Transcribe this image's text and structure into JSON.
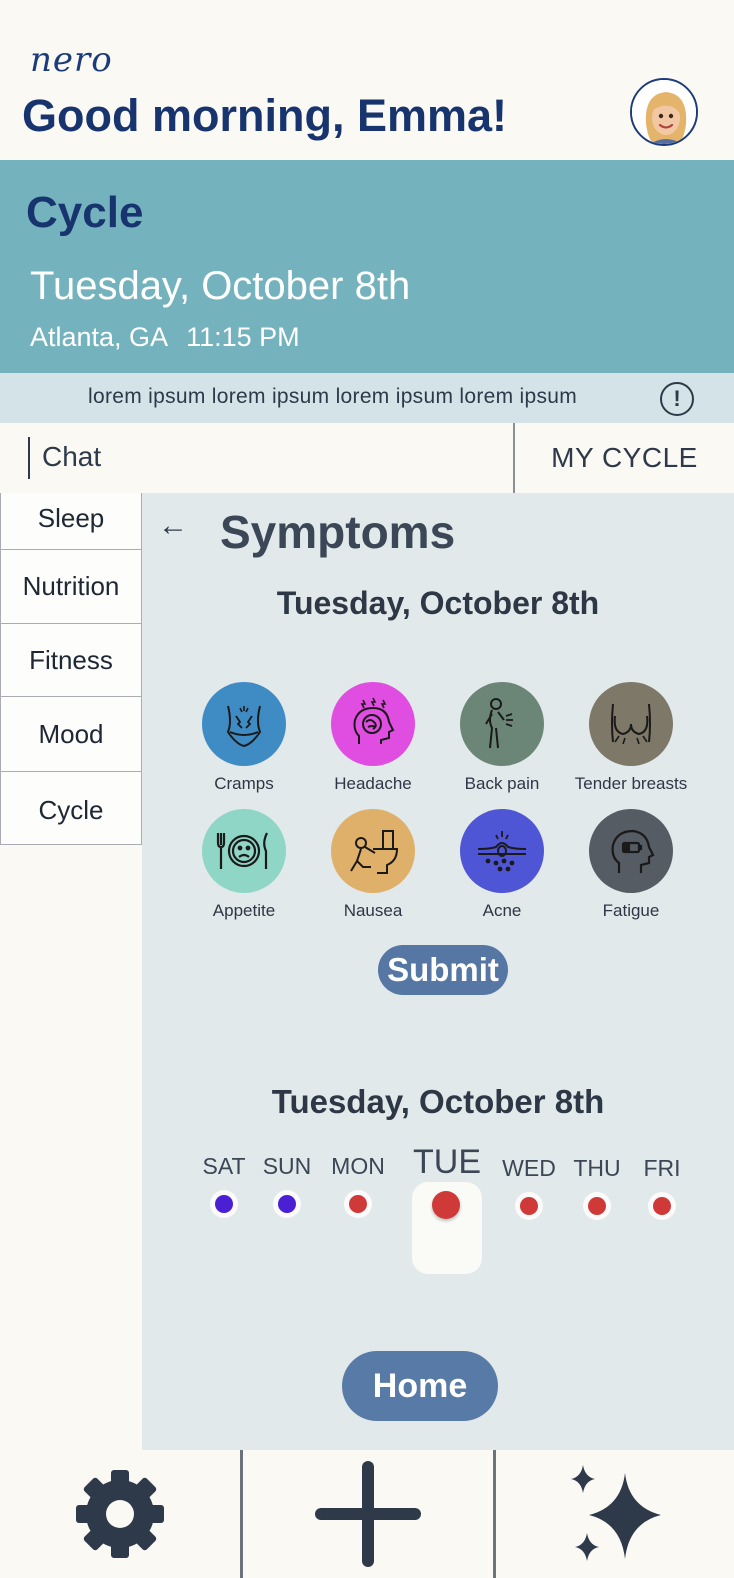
{
  "header": {
    "logo": "nero",
    "greeting": "Good morning, Emma!",
    "avatar_icon": "avatar-icon"
  },
  "cycle": {
    "title": "Cycle",
    "date": "Tuesday, October 8th",
    "location": "Atlanta, GA",
    "time": "11:15 PM"
  },
  "info": {
    "text": "lorem ipsum lorem ipsum lorem ipsum lorem ipsum",
    "icon": "!"
  },
  "tabs": {
    "chat": "Chat",
    "my_cycle": "MY CYCLE"
  },
  "sidebar": {
    "items": [
      {
        "label": "Sleep"
      },
      {
        "label": "Nutrition"
      },
      {
        "label": "Fitness"
      },
      {
        "label": "Mood"
      },
      {
        "label": "Cycle"
      }
    ]
  },
  "symptoms": {
    "back": "←",
    "title": "Symptoms",
    "date": "Tuesday, October 8th",
    "items": [
      {
        "label": "Cramps",
        "color": "#3f8bc4",
        "icon": "cramps-icon"
      },
      {
        "label": "Headache",
        "color": "#df4ee0",
        "icon": "headache-icon"
      },
      {
        "label": "Back pain",
        "color": "#6b8677",
        "icon": "back-pain-icon"
      },
      {
        "label": "Tender breasts",
        "color": "#7d7868",
        "icon": "tender-breasts-icon"
      },
      {
        "label": "Appetite",
        "color": "#8fd6c6",
        "icon": "appetite-icon"
      },
      {
        "label": "Nausea",
        "color": "#deb069",
        "icon": "nausea-icon"
      },
      {
        "label": "Acne",
        "color": "#4f56d6",
        "icon": "acne-icon"
      },
      {
        "label": "Fatigue",
        "color": "#565c63",
        "icon": "fatigue-icon"
      }
    ],
    "submit_label": "Submit"
  },
  "week": {
    "date": "Tuesday, October 8th",
    "days": [
      {
        "label": "SAT",
        "color": "#4b1fd4"
      },
      {
        "label": "SUN",
        "color": "#4b1fd4"
      },
      {
        "label": "MON",
        "color": "#cf3a38"
      },
      {
        "label": "TUE",
        "color": "#cf3a38"
      },
      {
        "label": "WED",
        "color": "#cf3a38"
      },
      {
        "label": "THU",
        "color": "#cf3a38"
      },
      {
        "label": "FRI",
        "color": "#cf3a38"
      }
    ],
    "selected_day": "TUE"
  },
  "home_label": "Home",
  "bottom_nav": {
    "icons": [
      "gear-icon",
      "plus-icon",
      "sparkle-icon"
    ]
  }
}
